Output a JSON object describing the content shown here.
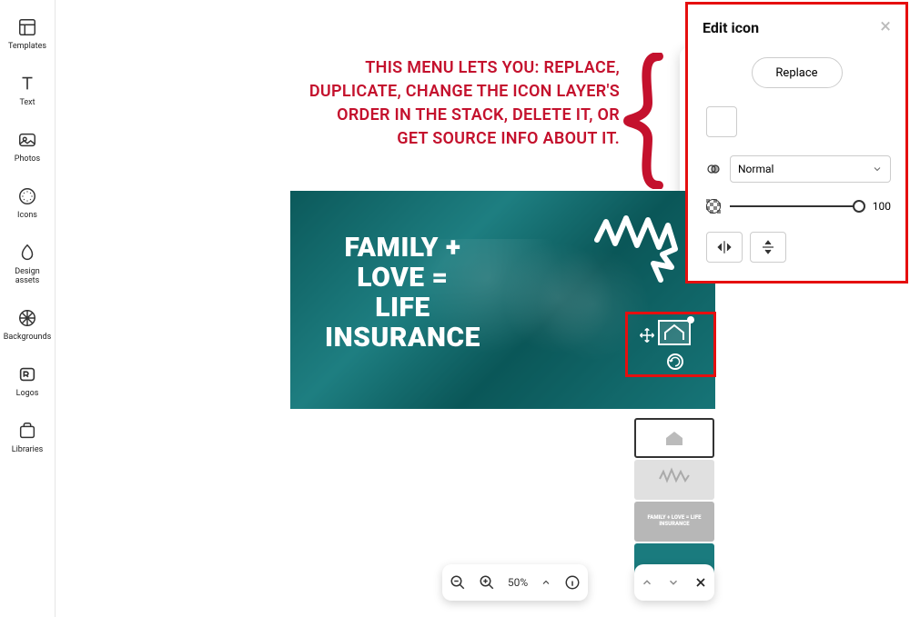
{
  "sidebar": {
    "items": [
      {
        "label": "Templates"
      },
      {
        "label": "Text"
      },
      {
        "label": "Photos"
      },
      {
        "label": "Icons"
      },
      {
        "label": "Design assets"
      },
      {
        "label": "Backgrounds"
      },
      {
        "label": "Logos"
      },
      {
        "label": "Libraries"
      }
    ]
  },
  "annotation": {
    "text": "THIS MENU LETS YOU: REPLACE, DUPLICATE, CHANGE THE ICON LAYER'S ORDER IN THE STACK, DELETE IT, OR GET SOURCE INFO ABOUT IT."
  },
  "design": {
    "main_text": "FAMILY + LOVE = LIFE INSURANCE"
  },
  "layers_thumb_text": "FAMILY + LOVE = LIFE INSURANCE",
  "zoom": {
    "value": "50%"
  },
  "edit_panel": {
    "title": "Edit icon",
    "replace_label": "Replace",
    "blend_mode": "Normal",
    "opacity": "100"
  },
  "colors": {
    "annotation_red": "#c4112d",
    "highlight_red": "#e50f0f",
    "design_teal": "#1a7b7e"
  }
}
